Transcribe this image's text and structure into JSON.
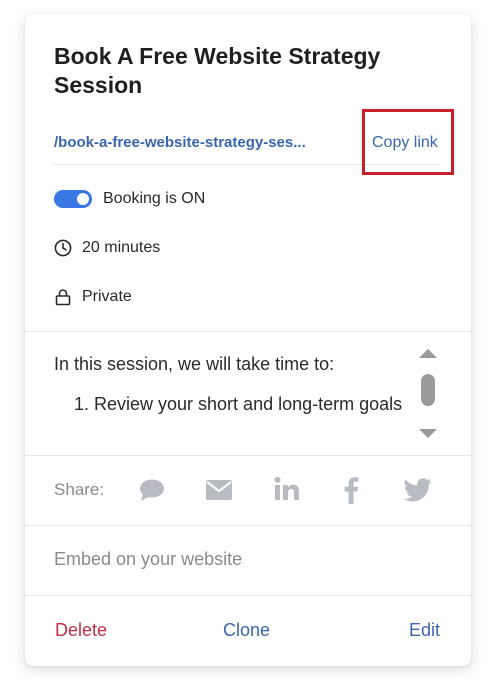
{
  "event": {
    "title": "Book A Free Website Strategy Session",
    "slug": "/book-a-free-website-strategy-ses...",
    "copy_link_label": "Copy link"
  },
  "status": {
    "booking_label": "Booking is ON",
    "booking_on": true,
    "duration": "20 minutes",
    "visibility": "Private"
  },
  "description": {
    "intro": "In this session, we will take time to:",
    "items": [
      "Review your short and long-term goals"
    ]
  },
  "share": {
    "label": "Share:",
    "icons": [
      "chat-bubble-icon",
      "email-icon",
      "linkedin-icon",
      "facebook-icon",
      "twitter-icon"
    ]
  },
  "embed": {
    "label": "Embed on your website"
  },
  "footer": {
    "delete_label": "Delete",
    "clone_label": "Clone",
    "edit_label": "Edit"
  },
  "colors": {
    "link": "#3b65b0",
    "delete": "#c0304a",
    "toggle_on": "#3a78e6",
    "highlight": "#c8202a",
    "muted": "#8a8a8a",
    "icon_gray": "#b8bcc2"
  }
}
